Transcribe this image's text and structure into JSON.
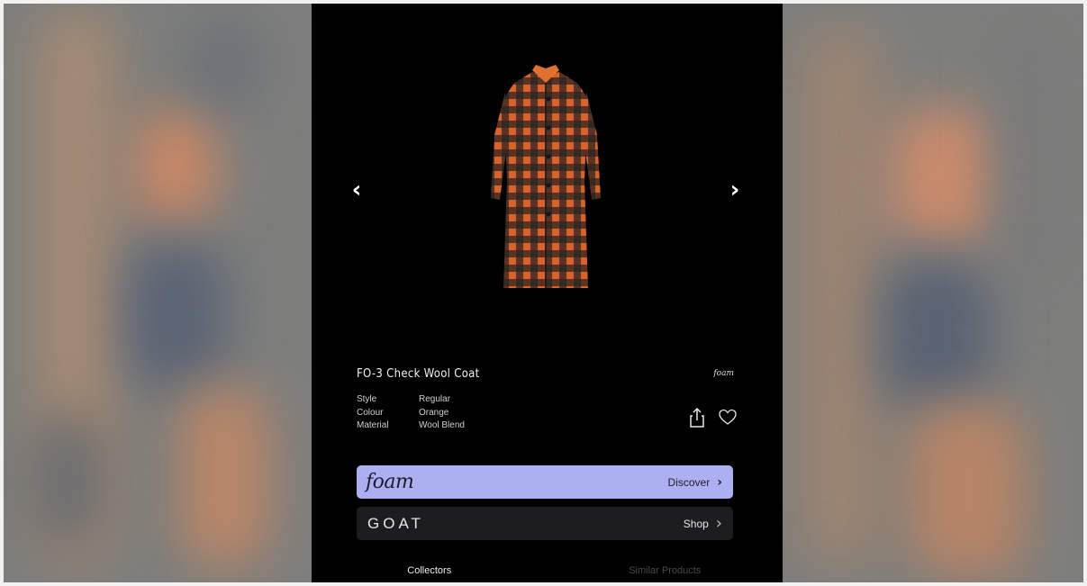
{
  "product": {
    "title": "FO-3 Check Wool Coat",
    "brand_mark": "foam",
    "specs": [
      {
        "label": "Style",
        "value": "Regular"
      },
      {
        "label": "Colour",
        "value": "Orange"
      },
      {
        "label": "Material",
        "value": "Wool Blend"
      }
    ]
  },
  "nav": {
    "prev_icon": "chevron-left-icon",
    "next_icon": "chevron-right-icon"
  },
  "actions": {
    "share_icon": "share-icon",
    "favorite_icon": "heart-icon"
  },
  "partners": [
    {
      "brand": "foam",
      "action": "Discover",
      "color": "#adb0f0"
    },
    {
      "brand": "GOAT",
      "action": "Shop",
      "color": "#1d1d1f"
    }
  ],
  "tabs": [
    {
      "label": "Collectors",
      "active": true
    },
    {
      "label": "Similar Products",
      "active": false
    }
  ]
}
